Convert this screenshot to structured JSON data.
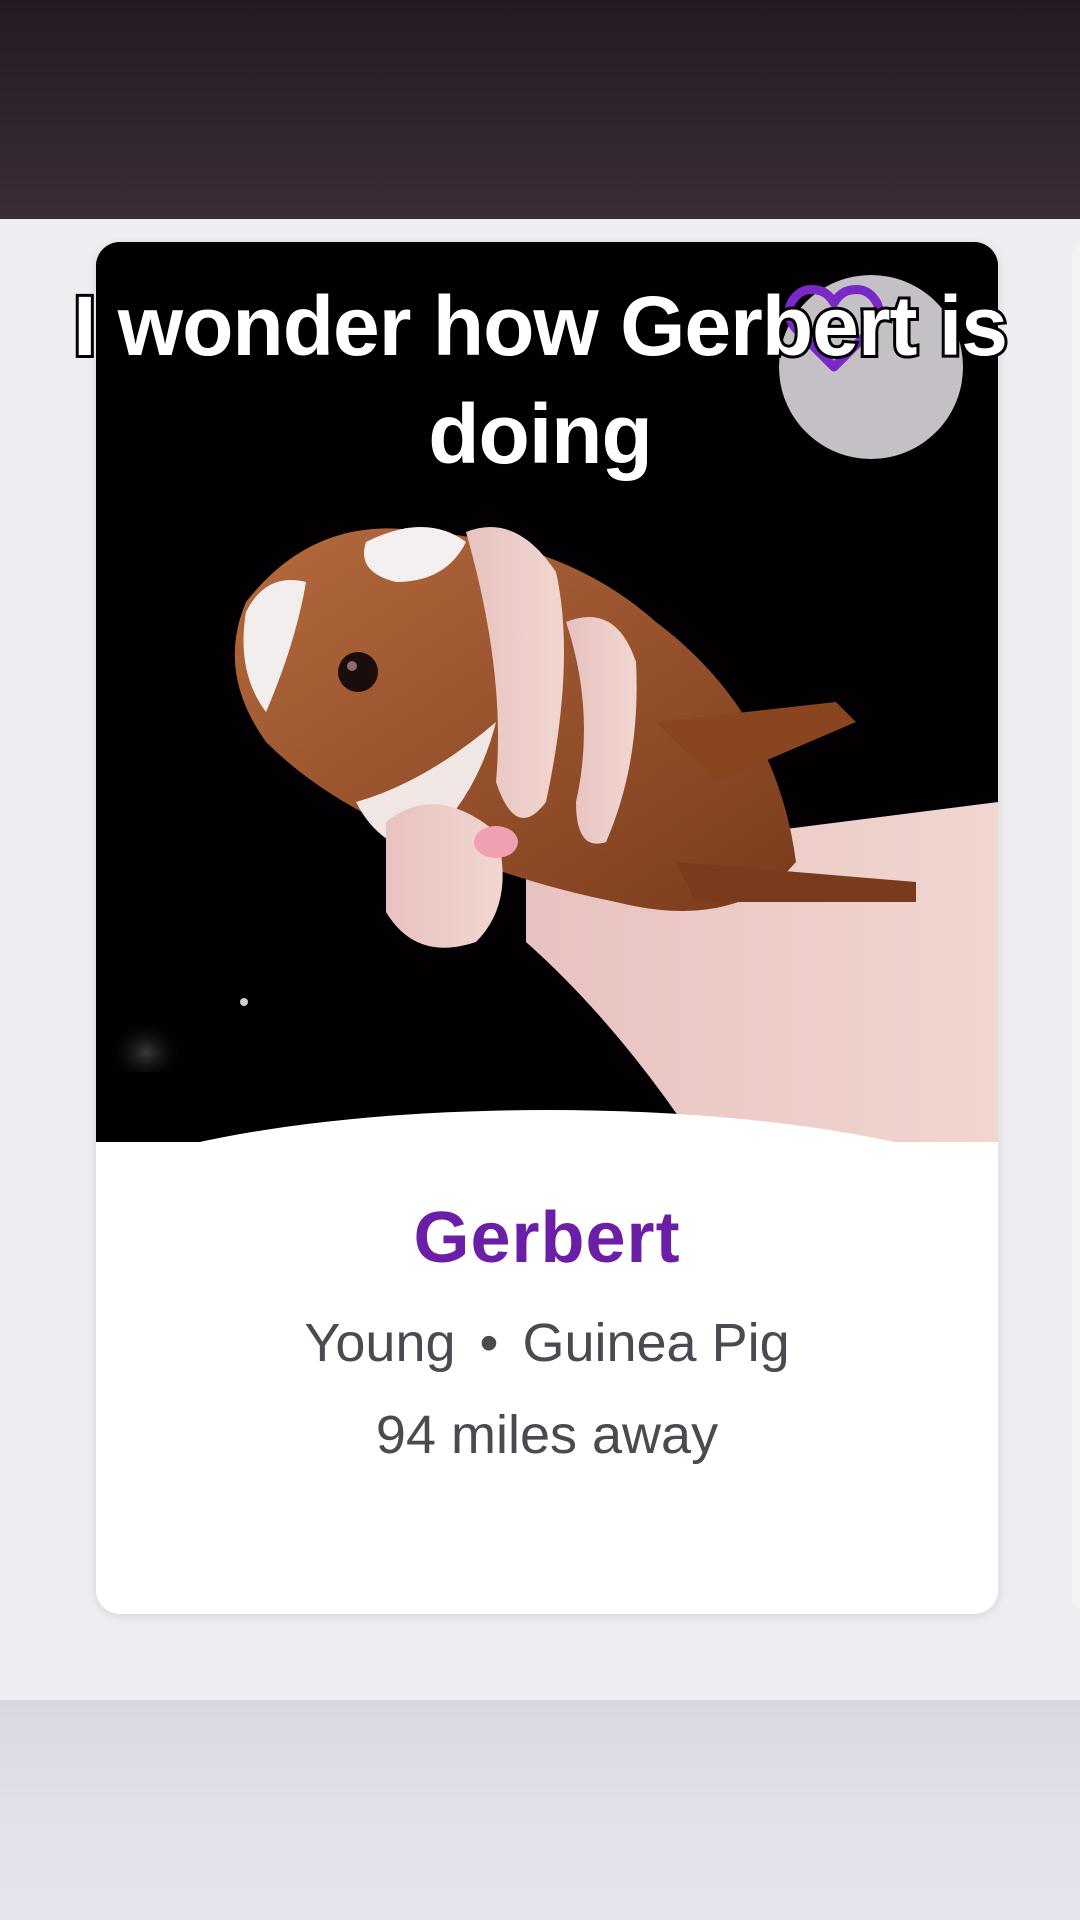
{
  "caption": {
    "line1": "I wonder how Gerbert is",
    "line2": "doing"
  },
  "pet": {
    "name": "Gerbert",
    "age": "Young",
    "separator": "•",
    "species": "Guinea Pig",
    "distance": "94 miles away",
    "photo_subject": "guinea pig held in hand",
    "favorite_icon": "heart-outline-icon"
  },
  "colors": {
    "name_purple": "#6a1fa6",
    "heart_purple": "#7a28c8",
    "top_bar": "#2e242c",
    "background": "#eeedf1"
  }
}
